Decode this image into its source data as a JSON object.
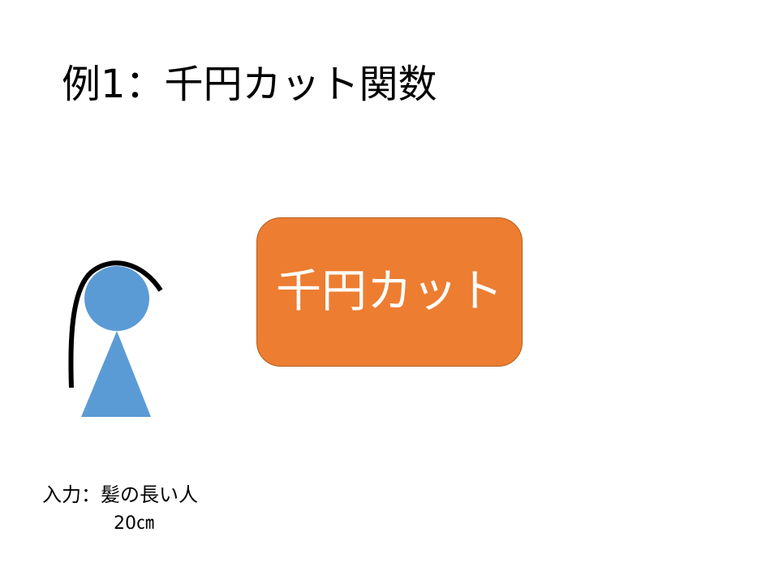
{
  "slide": {
    "title": "例1：千円カット関数"
  },
  "function_box": {
    "label": "千円カット",
    "fill_color": "#ED7D31"
  },
  "figure": {
    "body_color": "#5B9BD5",
    "hair_color": "#000000"
  },
  "input": {
    "label": "入力：髪の長い人",
    "value": "20㎝"
  }
}
